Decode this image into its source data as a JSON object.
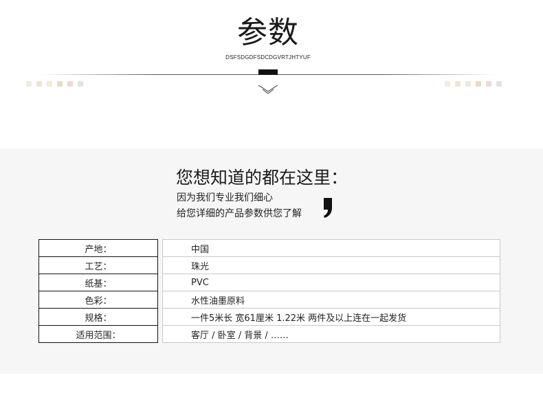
{
  "header": {
    "title": "参数",
    "code": "DSFSDGDFSDCDGVRTJHTYUF"
  },
  "decor": {
    "accent_color": "#111111",
    "left_squares": [
      "#f1ecdf",
      "#efe3cf",
      "#f3ead6",
      "#e8dcc2",
      "#f0d9d6",
      "#dde7df"
    ],
    "right_squares": [
      "#f1ecdf",
      "#eee6d2",
      "#ebeade",
      "#e8dcc2",
      "#f0d9d6",
      "#dde7df"
    ],
    "divider_icon": "chevron-down-icon",
    "quote_icon": "comma-quote-icon"
  },
  "intro": {
    "heading": "您想知道的都在这里：",
    "line1": "因为我们专业我们细心",
    "line2": "给您详细的产品参数供您了解"
  },
  "params": [
    {
      "label": "产地：",
      "value": "中国"
    },
    {
      "label": "工艺：",
      "value": "珠光"
    },
    {
      "label": "纸基：",
      "value": "PVC"
    },
    {
      "label": "色彩：",
      "value": "水性油墨原料"
    },
    {
      "label": "规格：",
      "value": "一件5米长 宽61厘米 1.22米    两件及以上连在一起发货"
    },
    {
      "label": "适用范围：",
      "value": "客厅 / 卧室 / 背景 /  ……"
    }
  ]
}
